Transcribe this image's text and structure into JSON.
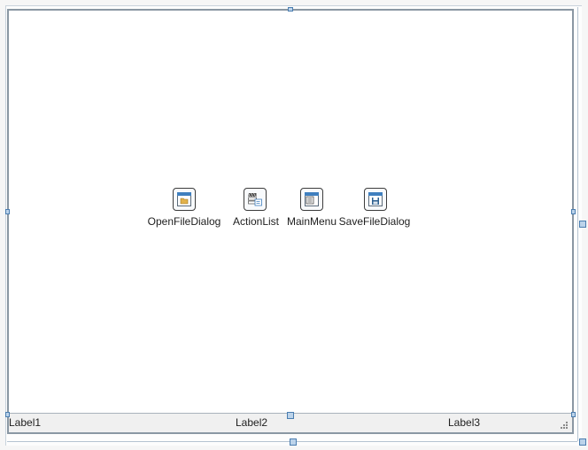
{
  "components": [
    {
      "id": "open-file-dialog",
      "label": "OpenFileDialog",
      "icon": "open-file-dialog-icon"
    },
    {
      "id": "action-list",
      "label": "ActionList",
      "icon": "action-list-icon"
    },
    {
      "id": "main-menu",
      "label": "MainMenu",
      "icon": "main-menu-icon"
    },
    {
      "id": "save-file-dialog",
      "label": "SaveFileDialog",
      "icon": "save-file-dialog-icon"
    }
  ],
  "status_bar": {
    "label1": "Label1",
    "label2": "Label2",
    "label3": "Label3"
  },
  "colors": {
    "form_border": "#8a97a3",
    "handle_fill": "#bcd3ea",
    "handle_border": "#4a7db0",
    "status_bar": "#f0f0f0"
  }
}
